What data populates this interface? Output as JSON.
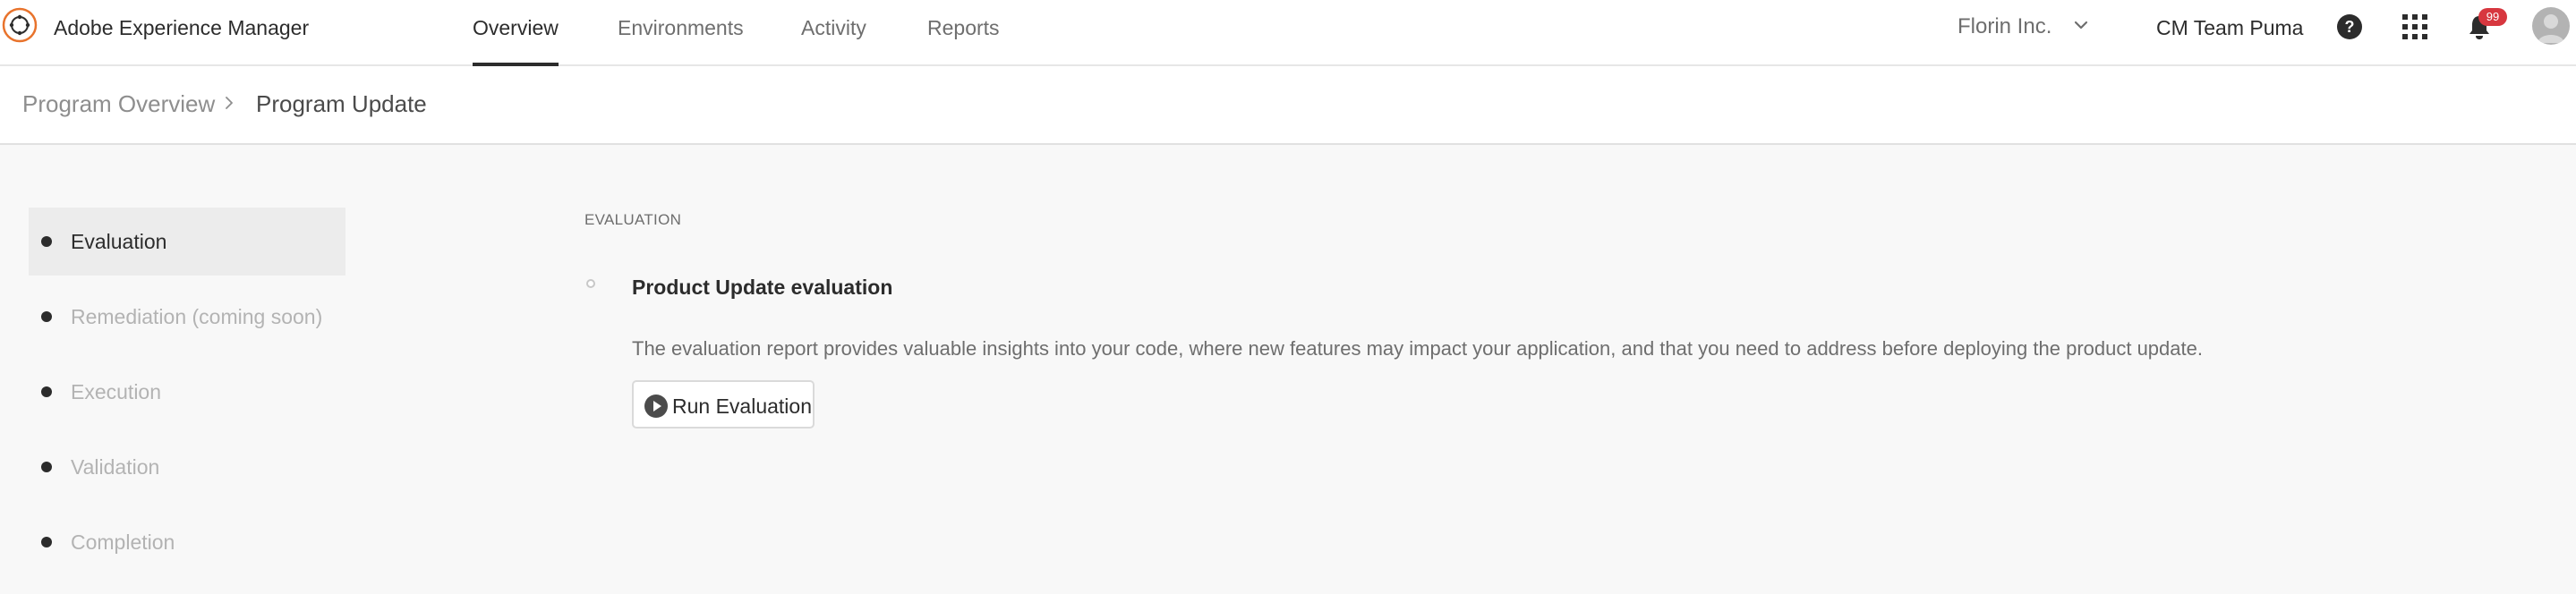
{
  "header": {
    "app_title": "Adobe Experience Manager",
    "tabs": [
      {
        "label": "Overview",
        "active": true
      },
      {
        "label": "Environments",
        "active": false
      },
      {
        "label": "Activity",
        "active": false
      },
      {
        "label": "Reports",
        "active": false
      }
    ],
    "org_name": "Florin Inc.",
    "team_name": "CM Team Puma",
    "notification_count": "99",
    "icons": [
      "adobe-logo-icon",
      "chevron-down-icon",
      "help-icon",
      "apps-grid-icon",
      "bell-icon",
      "avatar"
    ]
  },
  "breadcrumb": {
    "items": [
      "Program Overview",
      "Program Update"
    ]
  },
  "steps": [
    {
      "label": "Evaluation",
      "state": "active"
    },
    {
      "label": "Remediation (coming soon)",
      "state": "disabled"
    },
    {
      "label": "Execution",
      "state": "disabled"
    },
    {
      "label": "Validation",
      "state": "disabled"
    },
    {
      "label": "Completion",
      "state": "disabled"
    }
  ],
  "main": {
    "section_title": "EVALUATION",
    "item_title": "Product Update evaluation",
    "item_description": "The evaluation report provides valuable insights into your code, where new features may impact your application, and that you need to address before deploying the product update.",
    "run_button_label": "Run Evaluation"
  },
  "colors": {
    "accent_orange": "#e8732c",
    "badge_red": "#d7373f",
    "text_primary": "#2c2c2c",
    "text_muted": "#6e6e6e",
    "text_disabled": "#b3b3b3",
    "background": "#f8f8f8"
  }
}
